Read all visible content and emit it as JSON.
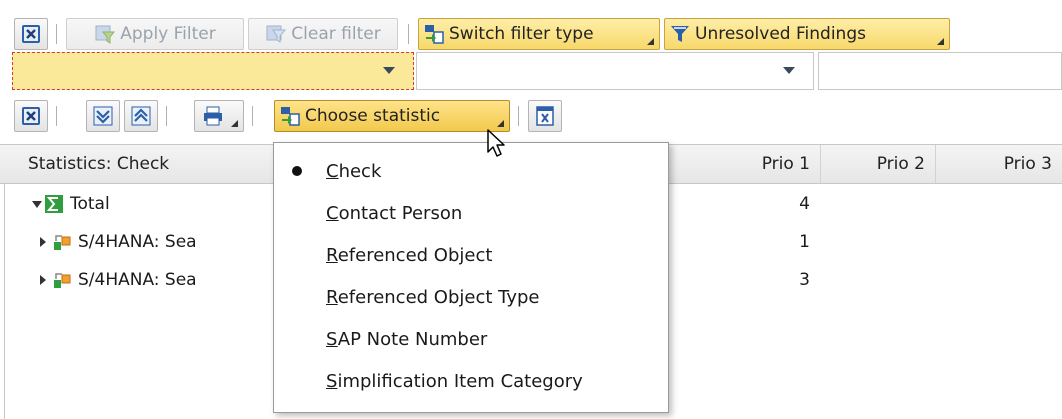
{
  "toolbar_top": {
    "apply_filter": "Apply Filter",
    "clear_filter": "Clear filter",
    "switch_filter_type": "Switch filter type",
    "unresolved_findings": "Unresolved Findings"
  },
  "filter_row": {
    "filter1_value": "",
    "filter2_value": "",
    "filter3_value": ""
  },
  "toolbar_second": {
    "choose_statistic": "Choose statistic"
  },
  "table": {
    "header_label": "Statistics: Check",
    "columns": [
      "Prio 1",
      "Prio 2",
      "Prio 3"
    ],
    "rows": [
      {
        "label": "Total",
        "prio1": "4"
      },
      {
        "label": "S/4HANA: Sea",
        "prio1": "1"
      },
      {
        "label": "S/4HANA: Sea",
        "prio1": "3"
      }
    ]
  },
  "menu": {
    "items": [
      {
        "mnemonic": "C",
        "rest": "heck",
        "selected": true
      },
      {
        "mnemonic": "C",
        "rest": "ontact Person",
        "selected": false
      },
      {
        "mnemonic": "R",
        "rest": "eferenced Object",
        "selected": false
      },
      {
        "mnemonic": "R",
        "rest": "eferenced Object Type",
        "selected": false
      },
      {
        "mnemonic": "S",
        "rest": "AP Note Number",
        "selected": false
      },
      {
        "mnemonic": "S",
        "rest": "implification Item Category",
        "selected": false
      }
    ]
  },
  "colors": {
    "accent_yellow": "#f7d86a",
    "focus_border": "#d43c3c",
    "sigma_green": "#2f9e3f",
    "icon_blue": "#2b5fa8"
  }
}
